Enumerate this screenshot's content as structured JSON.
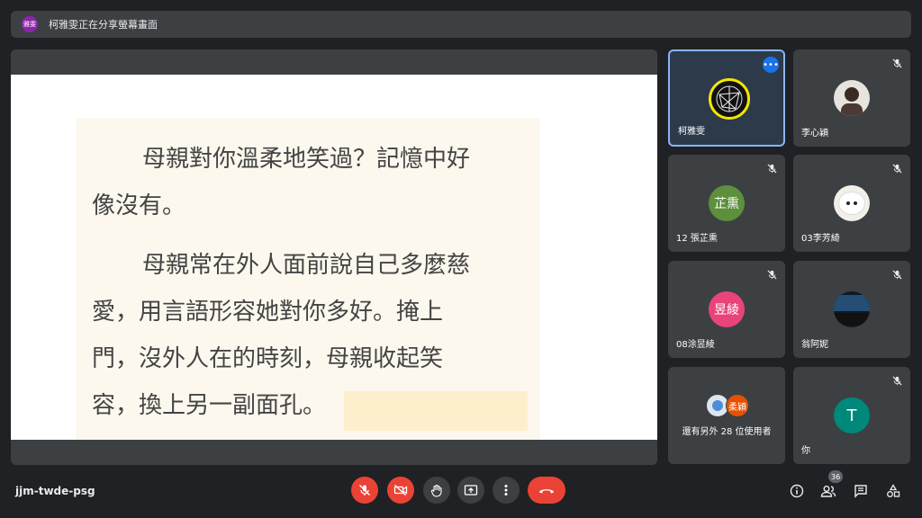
{
  "banner": {
    "presenter_initials": "雅雯",
    "text": "柯雅雯正在分享螢幕畫面"
  },
  "document": {
    "paragraphs": [
      [
        "母親對你溫柔地笑過？記憶中好",
        "像沒有。"
      ],
      [
        "母親常在外人面前說自己多麼慈",
        "愛，用言語形容她對你多好。掩上",
        "門，沒外人在的時刻，母親收起笑",
        "容，換上另一副面孔。"
      ]
    ]
  },
  "participants": [
    {
      "name": "柯雅雯",
      "type": "logo",
      "active": true
    },
    {
      "name": "李心穎",
      "type": "photo",
      "muted": true
    },
    {
      "name": "12 張芷熏",
      "type": "letter",
      "initials": "芷熏",
      "color": "#5d8f3c",
      "muted": true
    },
    {
      "name": "03李芳綺",
      "type": "photo",
      "muted": true
    },
    {
      "name": "08涂昱綾",
      "type": "letter",
      "initials": "昱綾",
      "color": "#e8447a",
      "muted": true
    },
    {
      "name": "翁阿妮",
      "type": "photo",
      "muted": true
    },
    {
      "name": "還有另外 28 位使用者",
      "type": "group",
      "initials": "柔穎",
      "color": "#e65100"
    },
    {
      "name": "你",
      "type": "letter",
      "initials": "T",
      "color": "#00897b",
      "muted": true
    }
  ],
  "bottom_bar": {
    "meeting_code": "jjm-twde-psg",
    "people_count": "36",
    "icons": [
      "mic-off-icon",
      "camera-off-icon",
      "raise-hand-icon",
      "present-icon",
      "more-vert-icon",
      "end-call-icon",
      "info-icon",
      "people-icon",
      "chat-icon",
      "activities-icon"
    ]
  },
  "colors": {
    "accent": "#8ab4f8",
    "danger": "#ea4335",
    "surface": "#3c4043",
    "background": "#202124"
  }
}
